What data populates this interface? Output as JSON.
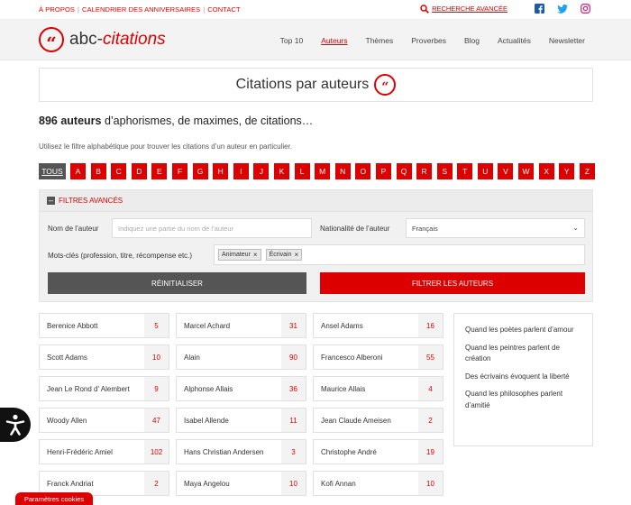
{
  "topbar": {
    "links": [
      "À PROPOS",
      "CALENDRIER DES ANNIVERSAIRES",
      "CONTACT"
    ],
    "advanced_search": "RECHERCHE AVANCÉE",
    "social": [
      "facebook-icon",
      "twitter-icon",
      "instagram-icon"
    ]
  },
  "header": {
    "logo_prefix": "abc-",
    "logo_suffix": "citations",
    "nav": [
      {
        "label": "Top 10",
        "active": false
      },
      {
        "label": "Auteurs",
        "active": true
      },
      {
        "label": "Thèmes",
        "active": false
      },
      {
        "label": "Proverbes",
        "active": false
      },
      {
        "label": "Blog",
        "active": false
      },
      {
        "label": "Actualités",
        "active": false
      },
      {
        "label": "Newsletter",
        "active": false
      }
    ]
  },
  "page": {
    "title": "Citations par auteurs",
    "count_number": "896 auteurs",
    "count_rest": " d’aphorismes, de maximes, de citations…",
    "instruction": "Utilisez le filtre alphabétique pour trouver les citations d’un auteur en particulier."
  },
  "alphabet": {
    "all_label": "TOUS",
    "letters": [
      "A",
      "B",
      "C",
      "D",
      "E",
      "F",
      "G",
      "H",
      "I",
      "J",
      "K",
      "L",
      "M",
      "N",
      "O",
      "P",
      "Q",
      "R",
      "S",
      "T",
      "U",
      "V",
      "W",
      "X",
      "Y",
      "Z"
    ]
  },
  "filters": {
    "header": "FILTRES AVANCÉS",
    "name_label": "Nom de l’auteur",
    "name_placeholder": "Indiquez une partie du nom de l’auteur",
    "nationality_label": "Nationalité de l’auteur",
    "nationality_value": "Français",
    "keywords_label": "Mots-clés (profession, titre, récompense etc.)",
    "tags": [
      "Animateur",
      "Écrivain"
    ],
    "reset_label": "RÉINITIALISER",
    "filter_label": "FILTRER LES AUTEURS"
  },
  "authors": [
    [
      {
        "name": "Berenice Abbott",
        "count": "5"
      },
      {
        "name": "Marcel Achard",
        "count": "31"
      },
      {
        "name": "Ansel Adams",
        "count": "16"
      }
    ],
    [
      {
        "name": "Scott Adams",
        "count": "10"
      },
      {
        "name": "Alain",
        "count": "90"
      },
      {
        "name": "Francesco Alberoni",
        "count": "55"
      }
    ],
    [
      {
        "name": "Jean Le Rond d' Alembert",
        "count": "9"
      },
      {
        "name": "Alphonse Allais",
        "count": "36"
      },
      {
        "name": "Maurice Allais",
        "count": "4"
      }
    ],
    [
      {
        "name": "Woody Allen",
        "count": "47"
      },
      {
        "name": "Isabel Allende",
        "count": "11"
      },
      {
        "name": "Jean Claude Ameisen",
        "count": "2"
      }
    ],
    [
      {
        "name": "Henri-Frédéric Amiel",
        "count": "102"
      },
      {
        "name": "Hans Christian Andersen",
        "count": "3"
      },
      {
        "name": "Christophe André",
        "count": "19"
      }
    ],
    [
      {
        "name": "Franck Andriat",
        "count": "2"
      },
      {
        "name": "Maya Angelou",
        "count": "10"
      },
      {
        "name": "Kofi Annan",
        "count": "10"
      }
    ]
  ],
  "sidebar": {
    "links": [
      "Quand les poètes parlent d’amour",
      "Quand les peintres parlent de création",
      "Des écrivains évoquent la liberté",
      "Quand les philosophes parlent d’amitié"
    ]
  },
  "cookies_label": "Paramètres cookies"
}
